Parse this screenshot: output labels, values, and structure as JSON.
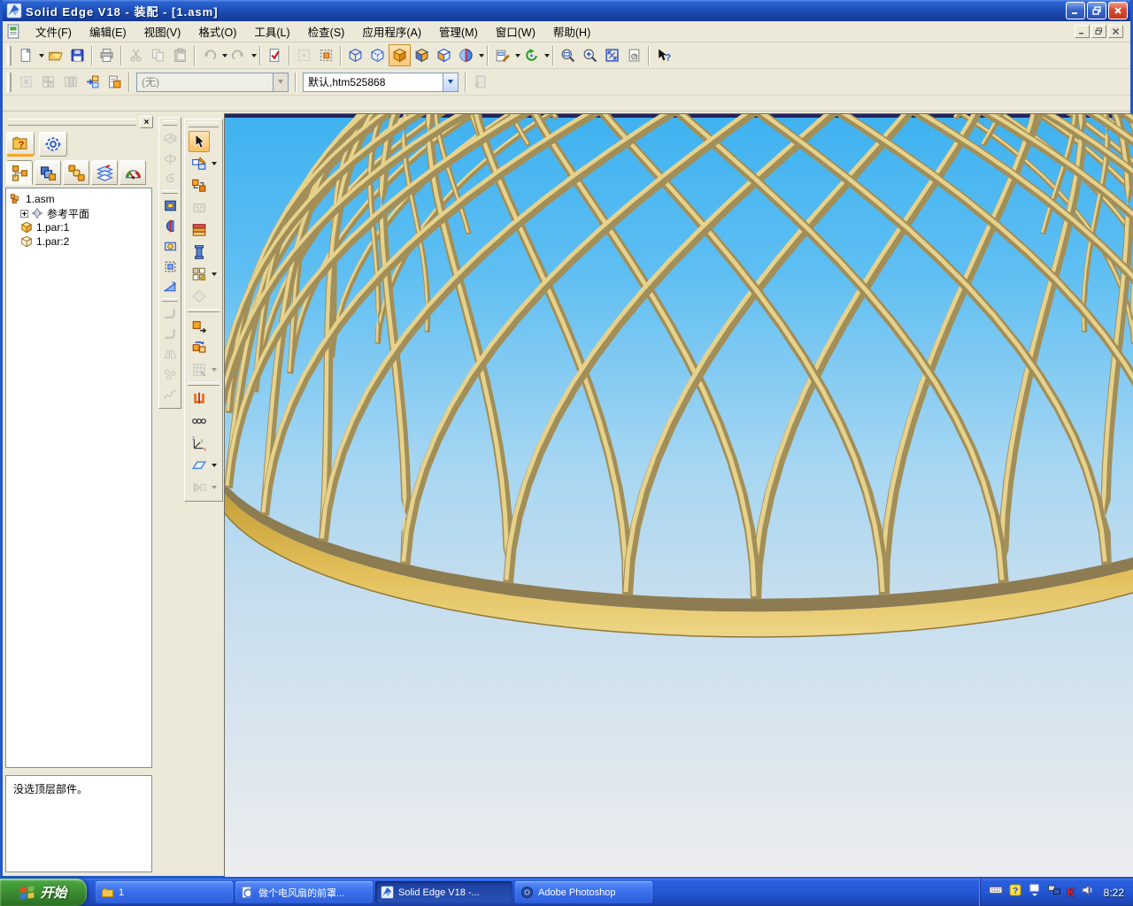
{
  "window": {
    "title": "Solid Edge V18 - 装配 - [1.asm]"
  },
  "menu_bar": {
    "items": [
      "文件(F)",
      "编辑(E)",
      "视图(V)",
      "格式(O)",
      "工具(L)",
      "检查(S)",
      "应用程序(A)",
      "管理(M)",
      "窗口(W)",
      "帮助(H)"
    ]
  },
  "toolbar_main": [
    {
      "name": "new-document-button",
      "glyph": "new-doc",
      "caret": true
    },
    {
      "name": "open-button",
      "glyph": "open-folder"
    },
    {
      "name": "save-button",
      "glyph": "save-floppy"
    },
    {
      "type": "sep"
    },
    {
      "name": "print-button",
      "glyph": "printer"
    },
    {
      "type": "sep"
    },
    {
      "name": "cut-button",
      "glyph": "cut",
      "disabled": true
    },
    {
      "name": "copy-button",
      "glyph": "copy",
      "disabled": true
    },
    {
      "name": "paste-button",
      "glyph": "paste",
      "disabled": true
    },
    {
      "type": "sep"
    },
    {
      "name": "undo-button",
      "glyph": "undo",
      "disabled": true,
      "caret": true
    },
    {
      "name": "redo-button",
      "glyph": "redo",
      "disabled": true,
      "caret": true
    },
    {
      "type": "sep"
    },
    {
      "name": "validate-document-button",
      "glyph": "doc-check"
    },
    {
      "type": "sep"
    },
    {
      "name": "select-visible-button",
      "glyph": "marquee",
      "disabled": true
    },
    {
      "name": "select-overlapping-button",
      "glyph": "marquee-orange"
    },
    {
      "type": "sep"
    },
    {
      "name": "wireframe-view-button",
      "glyph": "cube-wire"
    },
    {
      "name": "hidden-edge-view-button",
      "glyph": "cube-wire2"
    },
    {
      "name": "shaded-view-button",
      "glyph": "cube-orange",
      "active": true
    },
    {
      "name": "shaded-with-edges-button",
      "glyph": "cube-half"
    },
    {
      "name": "shaded-soft-button",
      "glyph": "cube-third"
    },
    {
      "name": "section-view-button",
      "glyph": "sphere-section",
      "caret": true
    },
    {
      "type": "sep"
    },
    {
      "name": "named-views-button",
      "glyph": "view-doc",
      "caret": true
    },
    {
      "name": "rotate-view-button",
      "glyph": "rotate-green",
      "caret": true
    },
    {
      "type": "sep"
    },
    {
      "name": "zoom-area-button",
      "glyph": "zoom-area"
    },
    {
      "name": "zoom-button",
      "glyph": "zoom"
    },
    {
      "name": "fit-view-button",
      "glyph": "fit"
    },
    {
      "name": "previous-view-button",
      "glyph": "pan-sheet"
    },
    {
      "type": "sep"
    },
    {
      "name": "help-pointer-button",
      "glyph": "help"
    }
  ],
  "toolbar_second": {
    "buttons": [
      {
        "name": "select-filter-button",
        "glyph": "r2a",
        "disabled": true
      },
      {
        "name": "display-configuration-button",
        "glyph": "r2b",
        "disabled": true
      },
      {
        "name": "part-visibility-button",
        "glyph": "r2c",
        "disabled": true
      },
      {
        "name": "activate-parts-button",
        "glyph": "r2d"
      },
      {
        "name": "configurations-button",
        "glyph": "r2e"
      }
    ],
    "style_combo": {
      "value": "(无)",
      "disabled": true
    },
    "config_combo": {
      "value": "默认,htm525868"
    },
    "end_button": {
      "name": "apply-configuration-button",
      "glyph": "r2end",
      "disabled": true
    }
  },
  "edgebar": {
    "big_tabs": [
      {
        "name": "help-library-tab",
        "glyph": "folder-question",
        "underline": true
      },
      {
        "name": "options-tab",
        "glyph": "gear"
      }
    ],
    "tabs": [
      {
        "name": "assembly-pathfinder-tab",
        "glyph": "tab-tree",
        "active": true
      },
      {
        "name": "parts-library-tab",
        "glyph": "tab-parts"
      },
      {
        "name": "alternate-assemblies-tab",
        "glyph": "tab-cascade"
      },
      {
        "name": "layers-tab",
        "glyph": "tab-layers"
      },
      {
        "name": "sensors-tab",
        "glyph": "tab-sensor"
      }
    ],
    "tree": [
      {
        "label": "1.asm",
        "icon": "asm",
        "level": 0,
        "plus": false
      },
      {
        "label": "参考平面",
        "icon": "planes",
        "level": 1,
        "plus": true
      },
      {
        "label": "1.par:1",
        "icon": "part",
        "level": 1,
        "plus": false
      },
      {
        "label": "1.par:2",
        "icon": "part2",
        "level": 1,
        "plus": false
      }
    ],
    "message": "没选顶层部件。"
  },
  "vtoolbar_left": [
    {
      "name": "protrusion-button",
      "glyph": "vt-solid",
      "disabled": true
    },
    {
      "name": "revolved-protrusion-button",
      "glyph": "vt-rotate",
      "disabled": true
    },
    {
      "name": "swept-protrusion-button",
      "glyph": "vt-swirl",
      "disabled": true
    },
    {
      "type": "sep"
    },
    {
      "name": "cutout-button",
      "glyph": "vt-blue-box"
    },
    {
      "name": "revolved-cutout-button",
      "glyph": "vt-clip-red"
    },
    {
      "name": "hole-button",
      "glyph": "vt-hole"
    },
    {
      "name": "swept-cutout-button",
      "glyph": "vt-dash-box"
    },
    {
      "name": "chamfer-button",
      "glyph": "vt-wedge"
    },
    {
      "type": "sep"
    },
    {
      "name": "bend-button",
      "glyph": "vt-bend",
      "disabled": true
    },
    {
      "name": "rebend-button",
      "glyph": "vt-bend",
      "disabled": true
    },
    {
      "name": "mirror-copy-button",
      "glyph": "vt-mirror",
      "disabled": true
    },
    {
      "name": "pattern-part-button",
      "glyph": "vt-balls",
      "disabled": true
    },
    {
      "name": "curve-button",
      "glyph": "vt-curve",
      "disabled": true
    }
  ],
  "vtoolbar_right": [
    {
      "name": "select-tool-button",
      "glyph": "select-arrow",
      "active": true
    },
    {
      "name": "sketch-button",
      "glyph": "sketch",
      "caret": true
    },
    {
      "name": "assemble-button",
      "glyph": "assemble"
    },
    {
      "name": "insert-part-button",
      "glyph": "face-gray",
      "disabled": true
    },
    {
      "name": "fastener-system-button",
      "glyph": "stack-red"
    },
    {
      "name": "insert-column-button",
      "glyph": "column-blue"
    },
    {
      "name": "pattern-button",
      "glyph": "pattern",
      "caret": true
    },
    {
      "name": "reference-button",
      "glyph": "diamond-gray",
      "disabled": true
    },
    {
      "type": "sep"
    },
    {
      "name": "drag-part-button",
      "glyph": "move-orange"
    },
    {
      "name": "replace-part-button",
      "glyph": "flip-orange"
    },
    {
      "name": "occurrence-properties-button",
      "glyph": "grid-gray",
      "caret": true,
      "disabled": true
    },
    {
      "type": "sep"
    },
    {
      "name": "clamp-button",
      "glyph": "clamp-red"
    },
    {
      "name": "relationships-button",
      "glyph": "chain"
    },
    {
      "name": "coordinate-system-button",
      "glyph": "xyz"
    },
    {
      "name": "reference-plane-button",
      "glyph": "plane-blue",
      "caret": true
    },
    {
      "name": "activate-part-button",
      "glyph": "activate-gray",
      "caret": true,
      "disabled": true
    }
  ],
  "viewport": {
    "colors": {
      "sky_top": "#3fb2f0",
      "sky_mid": "#a6d6f2",
      "sky_low": "#c4ddee",
      "ground": "#ededee",
      "horizon_line": "#23235f",
      "wire_base": "#a28e58",
      "wire_highlight": "#e7d28c",
      "rim_top_face": "#8d7c52",
      "rim_face_dark": "#a98e35",
      "rim_face_light": "#edd687",
      "rim_edge": "#8f793b"
    },
    "mesh": {
      "wires_per_family": 40,
      "phi_step_deg": 9,
      "twist_rad": 2.2,
      "theta_rim": 1.41,
      "cap_height": 0.85
    }
  },
  "taskbar": {
    "start_label": "开始",
    "items": [
      {
        "label": "1",
        "icon": "tb-folder"
      },
      {
        "label": "做个电风扇的前罩...",
        "icon": "tb-ie"
      },
      {
        "label": "Solid Edge V18 -...",
        "icon": "tb-se",
        "active": true
      },
      {
        "label": "Adobe Photoshop",
        "icon": "tb-ps"
      }
    ],
    "tray": {
      "icons": [
        {
          "name": "keyboard-tray-icon",
          "glyph": "tr-kbd"
        },
        {
          "name": "input-method-tray-icon",
          "glyph": "tr-q"
        },
        {
          "name": "restore-tray-icon",
          "glyph": "tr-restore"
        },
        {
          "name": "network-tray-icon",
          "glyph": "tr-net"
        },
        {
          "name": "kaspersky-tray-icon",
          "glyph": "tr-k"
        },
        {
          "name": "volume-tray-icon",
          "glyph": "tr-vol"
        }
      ],
      "time": "8:22"
    }
  }
}
